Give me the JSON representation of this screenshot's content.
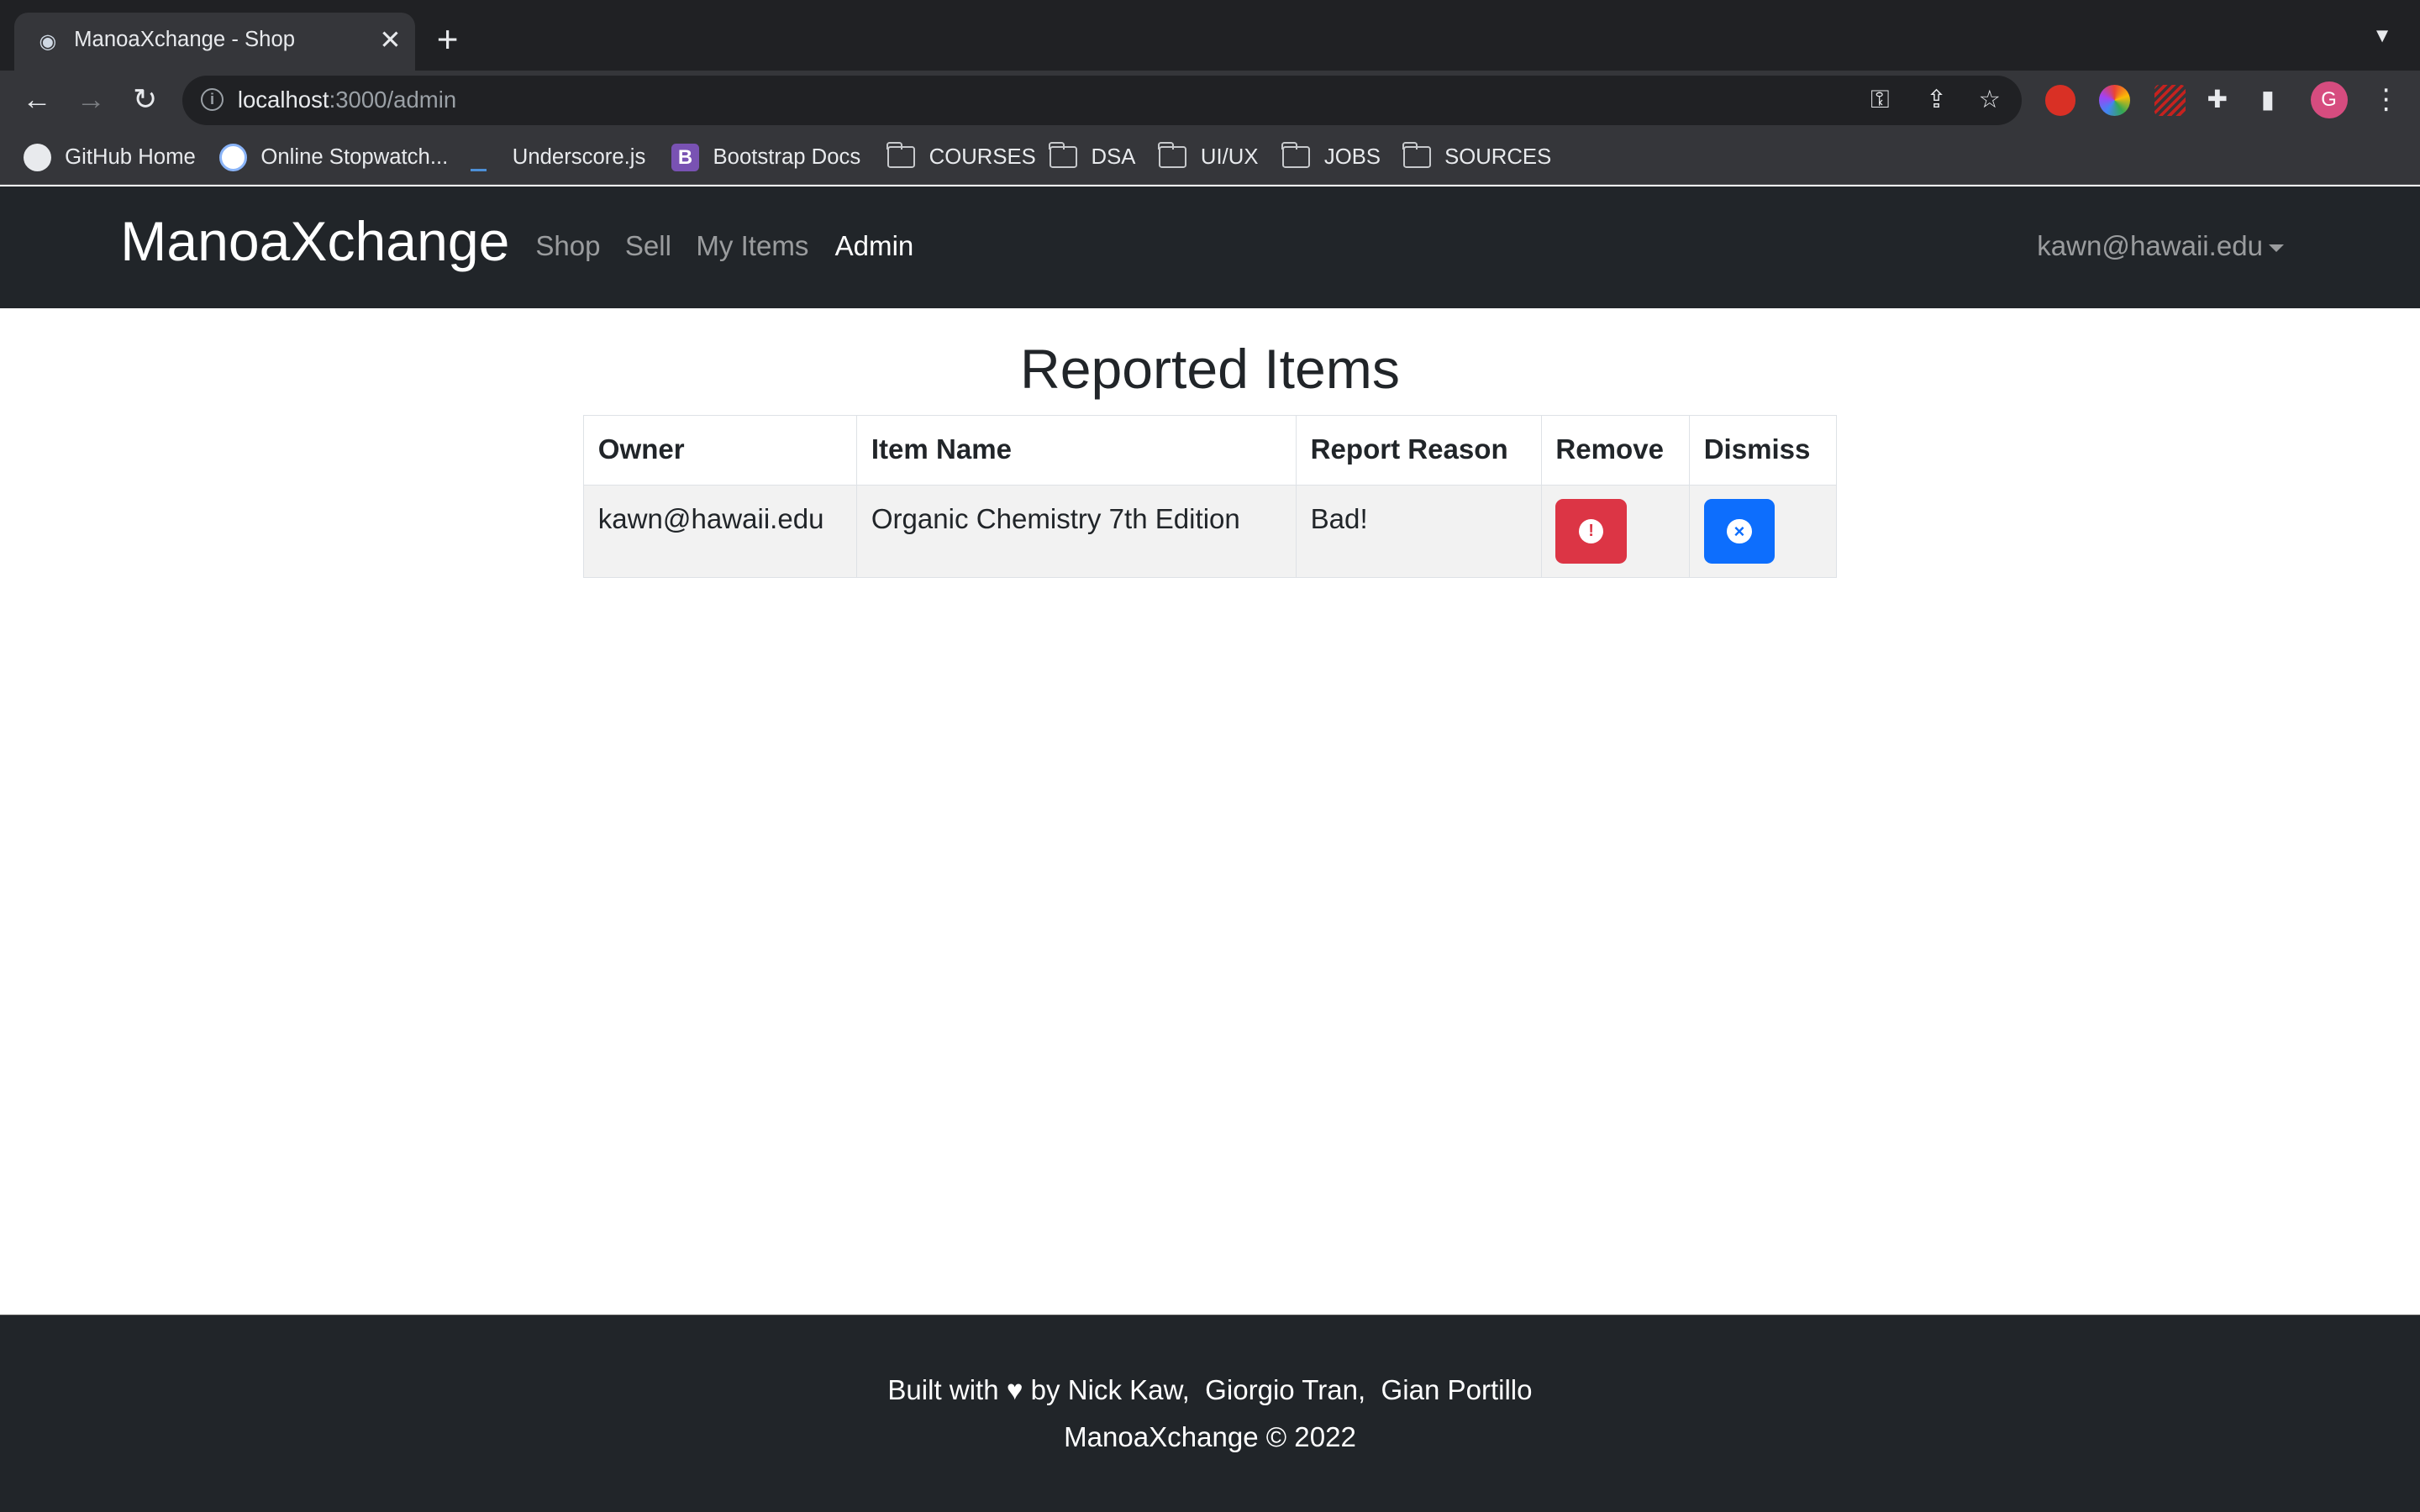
{
  "browser": {
    "tab_title": "ManoaXchange - Shop",
    "url_host": "localhost",
    "url_path": ":3000/admin",
    "bookmarks": [
      {
        "label": "GitHub Home",
        "icon": "github-icon"
      },
      {
        "label": "Online Stopwatch...",
        "icon": "stopwatch-icon"
      },
      {
        "label": "Underscore.js",
        "icon": "underscore-icon"
      },
      {
        "label": "Bootstrap Docs",
        "icon": "bootstrap-icon"
      },
      {
        "label": "COURSES",
        "icon": "folder-icon"
      },
      {
        "label": "DSA",
        "icon": "folder-icon"
      },
      {
        "label": "UI/UX",
        "icon": "folder-icon"
      },
      {
        "label": "JOBS",
        "icon": "folder-icon"
      },
      {
        "label": "SOURCES",
        "icon": "folder-icon"
      }
    ],
    "profile_initial": "G"
  },
  "navbar": {
    "brand": "ManoaXchange",
    "links": [
      "Shop",
      "Sell",
      "My Items",
      "Admin"
    ],
    "active": "Admin",
    "user": "kawn@hawaii.edu"
  },
  "main": {
    "title": "Reported Items",
    "columns": [
      "Owner",
      "Item Name",
      "Report Reason",
      "Remove",
      "Dismiss"
    ],
    "rows": [
      {
        "owner": "kawn@hawaii.edu",
        "item_name": "Organic Chemistry 7th Edition",
        "reason": "Bad!"
      }
    ]
  },
  "footer": {
    "built_prefix": "Built with",
    "built_suffix": "by Nick Kaw,  Giorgio Tran,  Gian Portillo",
    "copyright": "ManoaXchange © 2022"
  },
  "colors": {
    "navbar_bg": "#212529",
    "remove_button": "#dc3545",
    "dismiss_button": "#0d6efd"
  }
}
